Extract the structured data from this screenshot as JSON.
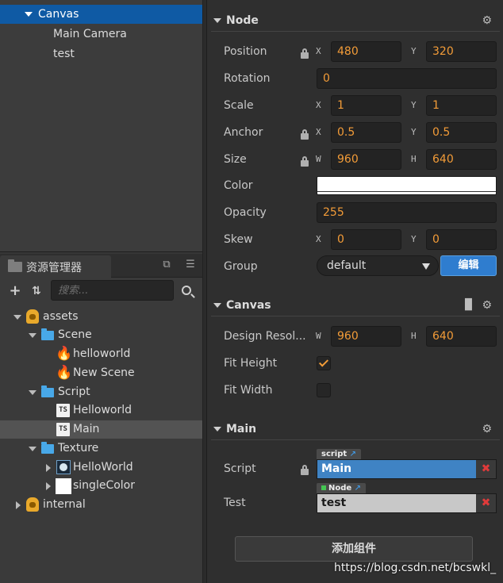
{
  "hierarchy": {
    "items": [
      {
        "label": "Canvas"
      },
      {
        "label": "Main Camera"
      },
      {
        "label": "test"
      }
    ]
  },
  "assets": {
    "tab_label": "资源管理器",
    "search_placeholder": "搜索...",
    "tree": [
      {
        "label": "assets",
        "icon": "database-icon"
      },
      {
        "label": "Scene",
        "icon": "folder-icon"
      },
      {
        "label": "helloworld",
        "icon": "fire-icon"
      },
      {
        "label": "New Scene",
        "icon": "fire-icon"
      },
      {
        "label": "Script",
        "icon": "folder-icon"
      },
      {
        "label": "Helloworld",
        "icon": "ts-file-icon"
      },
      {
        "label": "Main",
        "icon": "ts-file-icon"
      },
      {
        "label": "Texture",
        "icon": "folder-icon"
      },
      {
        "label": "HelloWorld",
        "icon": "image-icon"
      },
      {
        "label": "singleColor",
        "icon": "image-icon"
      },
      {
        "label": "internal",
        "icon": "database-icon"
      }
    ],
    "ts_badge": "TS"
  },
  "inspector": {
    "node": {
      "title": "Node",
      "position": {
        "label": "Position",
        "x_axis": "X",
        "y_axis": "Y",
        "x": "480",
        "y": "320"
      },
      "rotation": {
        "label": "Rotation",
        "value": "0"
      },
      "scale": {
        "label": "Scale",
        "x_axis": "X",
        "y_axis": "Y",
        "x": "1",
        "y": "1"
      },
      "anchor": {
        "label": "Anchor",
        "x_axis": "X",
        "y_axis": "Y",
        "x": "0.5",
        "y": "0.5"
      },
      "size": {
        "label": "Size",
        "w_axis": "W",
        "h_axis": "H",
        "w": "960",
        "h": "640"
      },
      "color": {
        "label": "Color",
        "value": "#ffffff"
      },
      "opacity": {
        "label": "Opacity",
        "value": "255"
      },
      "skew": {
        "label": "Skew",
        "x_axis": "X",
        "y_axis": "Y",
        "x": "0",
        "y": "0"
      },
      "group": {
        "label": "Group",
        "value": "default",
        "edit_button": "编辑"
      }
    },
    "canvas": {
      "title": "Canvas",
      "design_resolution": {
        "label": "Design Resol...",
        "w_axis": "W",
        "h_axis": "H",
        "w": "960",
        "h": "640"
      },
      "fit_height": {
        "label": "Fit Height",
        "checked": true
      },
      "fit_width": {
        "label": "Fit Width",
        "checked": false
      }
    },
    "main": {
      "title": "Main",
      "script": {
        "label": "Script",
        "tag": "script",
        "value": "Main"
      },
      "test": {
        "label": "Test",
        "tag": "Node",
        "value": "test"
      }
    },
    "add_component": "添加组件"
  },
  "colors": {
    "selection": "#0f5aa4",
    "number_text": "#f39c38",
    "script_field": "#3f83c4",
    "node_field": "#c8c8c8",
    "edit_button": "#2f7dcf"
  },
  "watermark": "https://blog.csdn.net/bcswkl_"
}
